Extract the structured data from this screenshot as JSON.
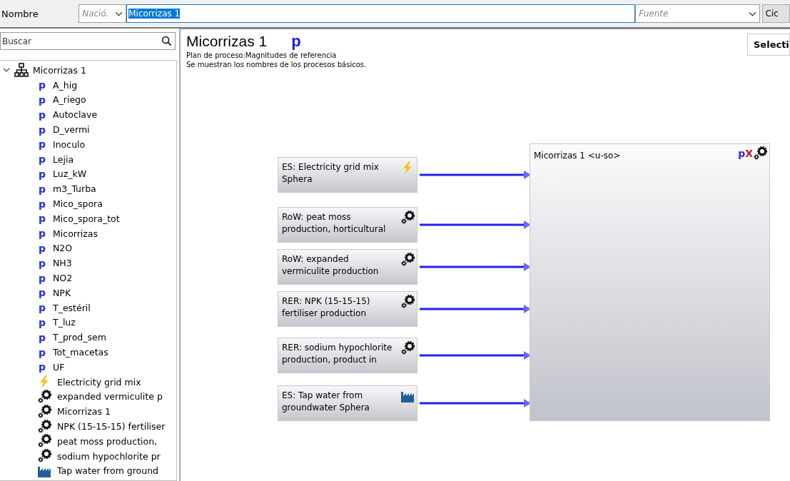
{
  "toolbar": {
    "name_label": "Nombre",
    "nation": {
      "placeholder": "Nació."
    },
    "name_field": {
      "value": "Micorrizas 1",
      "selected": true
    },
    "source": {
      "placeholder": "Fuente"
    },
    "cut_button": "Cic"
  },
  "sidebar": {
    "search": {
      "placeholder": "Buscar"
    },
    "tree": [
      {
        "label": "Micorrizas 1",
        "kind": "plan",
        "expanded": true,
        "children": [
          {
            "label": "A_hig",
            "kind": "param",
            "glyph": "p"
          },
          {
            "label": "A_riego",
            "kind": "param",
            "glyph": "p"
          },
          {
            "label": "Autoclave",
            "kind": "param",
            "glyph": "p"
          },
          {
            "label": "D_vermi",
            "kind": "param",
            "glyph": "p"
          },
          {
            "label": "Inoculo",
            "kind": "param",
            "glyph": "p"
          },
          {
            "label": "Lejia",
            "kind": "param",
            "glyph": "p"
          },
          {
            "label": "Luz_kW",
            "kind": "param",
            "glyph": "p"
          },
          {
            "label": "m3_Turba",
            "kind": "param",
            "glyph": "p"
          },
          {
            "label": "Mico_spora",
            "kind": "param",
            "glyph": "p"
          },
          {
            "label": "Mico_spora_tot",
            "kind": "param",
            "glyph": "p"
          },
          {
            "label": "Micorrizas",
            "kind": "param",
            "glyph": "p"
          },
          {
            "label": "N2O",
            "kind": "param",
            "glyph": "p"
          },
          {
            "label": "NH3",
            "kind": "param",
            "glyph": "p"
          },
          {
            "label": "NO2",
            "kind": "param",
            "glyph": "p"
          },
          {
            "label": "NPK",
            "kind": "param",
            "glyph": "p"
          },
          {
            "label": "T_estéril",
            "kind": "param",
            "glyph": "p"
          },
          {
            "label": "T_luz",
            "kind": "param",
            "glyph": "p"
          },
          {
            "label": "T_prod_sem",
            "kind": "param",
            "glyph": "p"
          },
          {
            "label": "Tot_macetas",
            "kind": "param",
            "glyph": "p"
          },
          {
            "label": "UF",
            "kind": "param",
            "glyph": "p"
          },
          {
            "label": "Electricity grid mix",
            "kind": "electricity"
          },
          {
            "label": "expanded vermiculite p",
            "kind": "process"
          },
          {
            "label": "Micorrizas 1",
            "kind": "process"
          },
          {
            "label": "NPK (15-15-15) fertiliser",
            "kind": "process"
          },
          {
            "label": "peat moss production,",
            "kind": "process"
          },
          {
            "label": "sodium hypochlorite pr",
            "kind": "process"
          },
          {
            "label": "Tap water from ground",
            "kind": "plant"
          }
        ]
      }
    ]
  },
  "main": {
    "title": "Micorrizas 1",
    "title_badge": "p",
    "subtitle": "Plan de proceso:Magnitudes de referencia",
    "note": "Se muestran los nombres de los procesos básicos.",
    "select_button": "Selecti",
    "diagram": {
      "inputs": [
        {
          "label": "ES: Electricity grid mix Sphera",
          "kind": "electricity"
        },
        {
          "label": "RoW: peat moss production, horticultural",
          "kind": "process"
        },
        {
          "label": "RoW: expanded vermiculite production",
          "kind": "process"
        },
        {
          "label": "RER: NPK (15-15-15) fertiliser production",
          "kind": "process"
        },
        {
          "label": "RER: sodium hypochlorite production, product in",
          "kind": "process"
        },
        {
          "label": "ES: Tap water from groundwater Sphera",
          "kind": "plant"
        }
      ],
      "target": {
        "label": "Micorrizas 1 <u-so>",
        "badge_p": "p",
        "badge_x": "X",
        "kind": "process"
      }
    }
  }
}
